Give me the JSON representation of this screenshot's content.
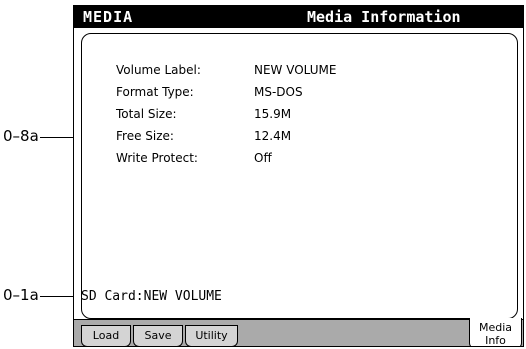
{
  "header": {
    "mode": "MEDIA",
    "page_title": "Media Information"
  },
  "media_info": {
    "rows": [
      {
        "label": "Volume Label:",
        "value": "NEW VOLUME"
      },
      {
        "label": "Format Type:",
        "value": "MS-DOS"
      },
      {
        "label": "Total Size:",
        "value": "15.9M"
      },
      {
        "label": "Free Size:",
        "value": "12.4M"
      },
      {
        "label": "Write Protect:",
        "value": "Off"
      }
    ]
  },
  "status": {
    "text": "SD Card:NEW VOLUME"
  },
  "tabs": {
    "load": "Load",
    "save": "Save",
    "utility": "Utility",
    "media_info_line1": "Media",
    "media_info_line2": "Info"
  },
  "callouts": {
    "media_info_ref": "0–8a",
    "status_ref": "0–1a"
  }
}
